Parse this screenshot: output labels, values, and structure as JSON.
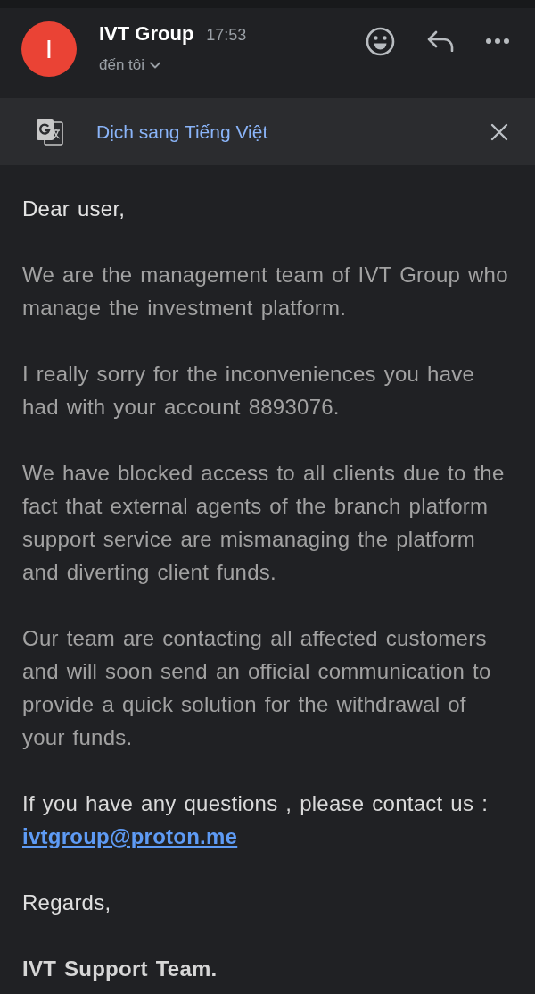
{
  "sender": {
    "avatar_letter": "I",
    "name": "IVT Group",
    "time": "17:53",
    "recipient": "đến tôi"
  },
  "translate_bar": {
    "label": "Dịch sang Tiếng Việt"
  },
  "body": [
    {
      "kind": "greeting",
      "text": "Dear user,"
    },
    {
      "kind": "paragraph",
      "text": "We are the management team of IVT Group who manage the investment platform."
    },
    {
      "kind": "paragraph",
      "text": "I really sorry for the inconveniences you have had with your account 8893076."
    },
    {
      "kind": "paragraph",
      "text": "We have blocked access to all clients due to the fact that external agents of the branch platform support service are mismanaging the platform and diverting client funds."
    },
    {
      "kind": "paragraph",
      "text": "Our team are contacting all affected customers and will soon send an official communication to provide a quick solution for the withdrawal of your funds."
    },
    {
      "kind": "contact",
      "text": "If you have any questions , please contact us :",
      "link": "ivtgroup@proton.me"
    },
    {
      "kind": "closing",
      "text": "Regards,"
    },
    {
      "kind": "signature",
      "text": "IVT Support Team."
    }
  ]
}
